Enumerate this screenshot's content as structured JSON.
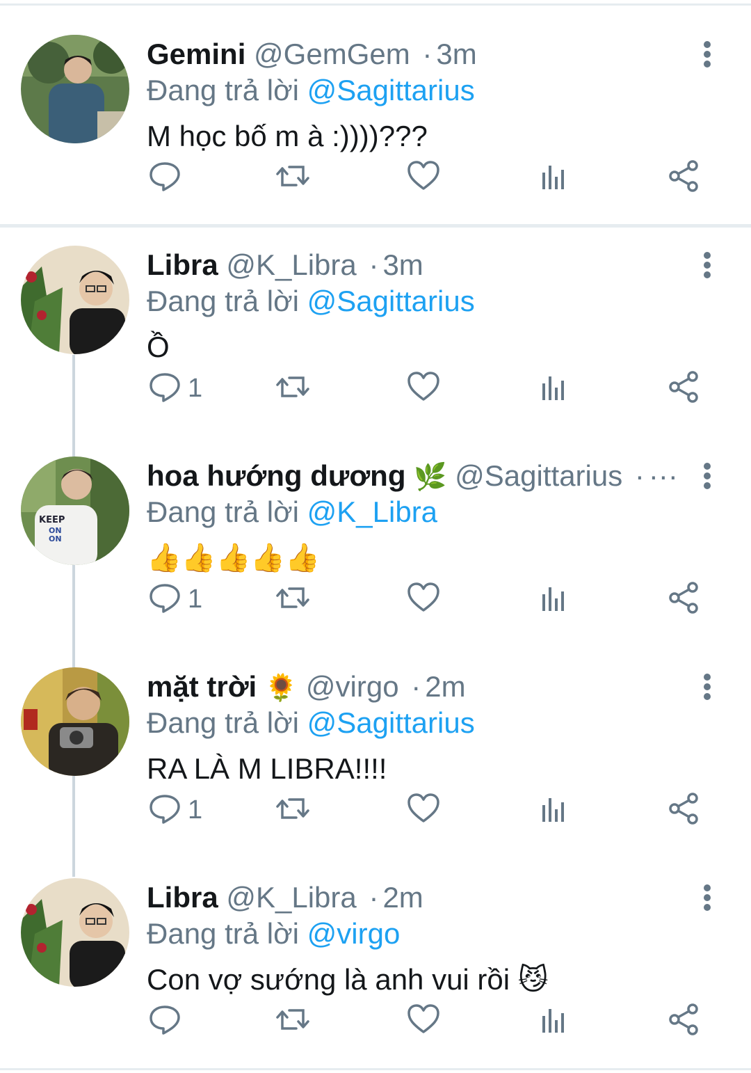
{
  "tweets": [
    {
      "name": "Gemini",
      "name_emoji": "",
      "handle": "@GemGem",
      "separator": "·",
      "time": "3m",
      "reply_prefix": "Đang trả lời",
      "reply_to": "@Sagittarius",
      "body": "M học bố m à :))))???",
      "reply_count": ""
    },
    {
      "name": "Libra",
      "name_emoji": "",
      "handle": "@K_Libra",
      "separator": "·",
      "time": "3m",
      "reply_prefix": "Đang trả lời",
      "reply_to": "@Sagittarius",
      "body": "Ồ",
      "reply_count": "1"
    },
    {
      "name": "hoa hướng dương",
      "name_emoji": "🌿",
      "handle": "@Sagittarius",
      "separator": "·",
      "time": "···",
      "reply_prefix": "Đang trả lời",
      "reply_to": "@K_Libra",
      "body": "👍👍👍👍👍",
      "reply_count": "1"
    },
    {
      "name": "mặt trời",
      "name_emoji": "🌻",
      "handle": "@virgo",
      "separator": "·",
      "time": "2m",
      "reply_prefix": "Đang trả lời",
      "reply_to": "@Sagittarius",
      "body": "RA LÀ M LIBRA!!!!",
      "reply_count": "1"
    },
    {
      "name": "Libra",
      "name_emoji": "",
      "handle": "@K_Libra",
      "separator": "·",
      "time": "2m",
      "reply_prefix": "Đang trả lời",
      "reply_to": "@virgo",
      "body": "Con vợ sướng là anh vui rồi 😼",
      "reply_count": ""
    }
  ],
  "icons": {
    "reply": "reply-icon",
    "retweet": "retweet-icon",
    "like": "heart-icon",
    "stats": "analytics-icon",
    "share": "share-icon",
    "more": "more-vertical-icon"
  },
  "colors": {
    "text": "#14171a",
    "muted": "#657786",
    "link": "#1da1f2",
    "divider": "#e6ecf0"
  }
}
